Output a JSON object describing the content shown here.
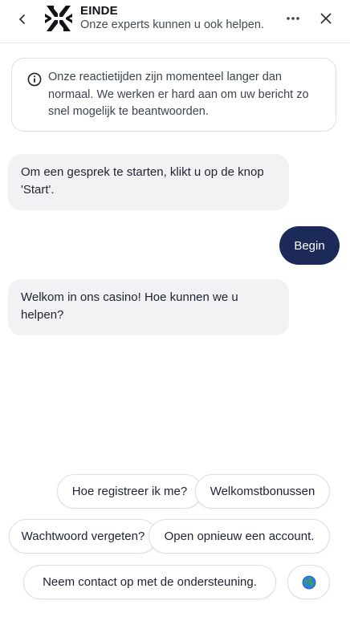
{
  "header": {
    "title": "EINDE",
    "subtitle": "Onze experts kunnen u ook helpen.",
    "back_icon": "chevron-left-icon",
    "more_icon": "more-horizontal-icon",
    "close_icon": "close-icon",
    "logo": "brand-logo"
  },
  "notice": {
    "icon": "info-icon",
    "text": "Onze reactietijden zijn momenteel langer dan normaal. We werken er hard aan om uw bericht zo snel mogelijk te beantwoorden."
  },
  "messages": [
    {
      "from": "bot",
      "text": "Om een gesprek te starten, klikt u op de knop 'Start'."
    },
    {
      "from": "user",
      "text": "Begin"
    },
    {
      "from": "bot",
      "text": "Welkom in ons casino! Hoe kunnen we u helpen?"
    }
  ],
  "quick_replies": [
    "Hoe registreer ik me?",
    "Welkomstbonussen",
    "Wachtwoord vergeten?",
    "Open opnieuw een account.",
    "Neem contact op met de ondersteuning.",
    "globe-icon"
  ],
  "colors": {
    "user_bubble": "#1c2a5a",
    "bot_bubble": "#f2f2f4",
    "border": "#dfe1e6"
  }
}
